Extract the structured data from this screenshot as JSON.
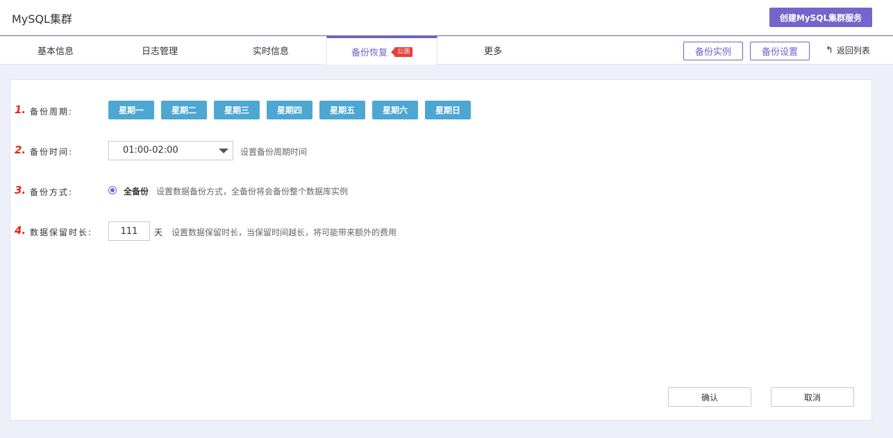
{
  "header": {
    "title": "MySQL集群",
    "create_button": "创建MySQL集群服务"
  },
  "tabs": [
    {
      "label": "基本信息"
    },
    {
      "label": "日志管理"
    },
    {
      "label": "实时信息"
    },
    {
      "label": "备份恢复",
      "badge": "公测"
    },
    {
      "label": "更多"
    }
  ],
  "actions": {
    "backup_instance": "备份实例",
    "backup_settings": "备份设置",
    "back_to_list": "返回列表"
  },
  "form": {
    "cycle": {
      "step": "1.",
      "label": "备份周期:",
      "days": [
        "星期一",
        "星期二",
        "星期三",
        "星期四",
        "星期五",
        "星期六",
        "星期日"
      ]
    },
    "time": {
      "step": "2.",
      "label": "备份时间:",
      "value": "01:00-02:00",
      "hint": "设置备份周期时间"
    },
    "method": {
      "step": "3.",
      "label": "备份方式:",
      "option": "全备份",
      "hint": "设置数据备份方式，全备份将会备份整个数据库实例"
    },
    "retention": {
      "step": "4.",
      "label": "数据保留时长:",
      "value": "111",
      "unit": "天",
      "hint": "设置数据保留时长，当保留时间越长，将可能带来额外的费用"
    }
  },
  "footer": {
    "confirm": "确认",
    "cancel": "取消"
  },
  "colors": {
    "accent": "#6c63c9",
    "day_button": "#4ea7d3",
    "badge": "#e8413a"
  }
}
